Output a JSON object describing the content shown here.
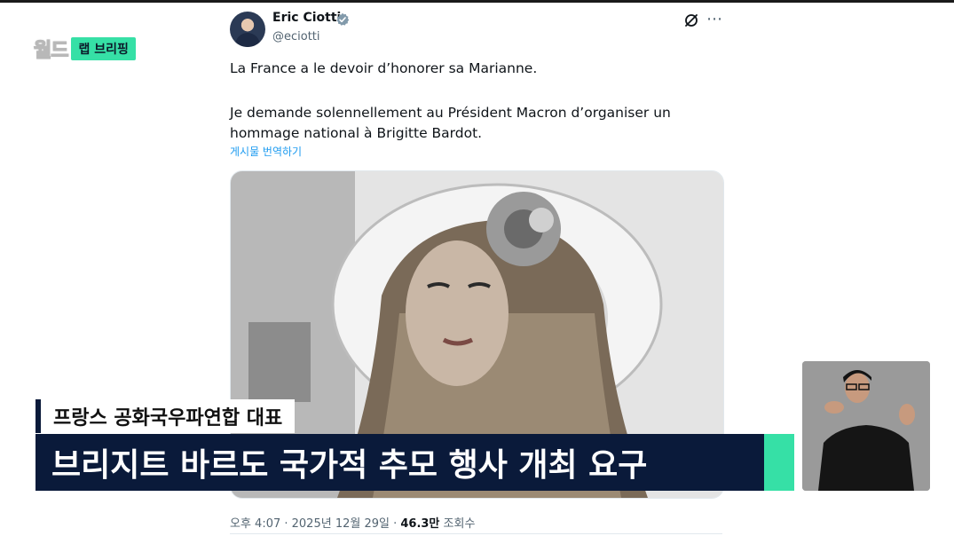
{
  "broadcast": {
    "logo_badge": "랩 브리핑"
  },
  "tweet": {
    "author_name": "Eric Ciotti",
    "author_handle": "@eciotti",
    "text_line1": "La France a le devoir d’honorer sa Marianne.",
    "text_line2": "Je demande solennellement au Président Macron d’organiser un",
    "text_line3": "hommage national à Brigitte Bardot.",
    "translate_link": "게시물 번역하기",
    "timestamp": "오후 4:07 · 2025년 12월 29일 · ",
    "views_count": "46.3만",
    "views_label": " 조회수"
  },
  "captions": {
    "subtitle": "프랑스 공화국우파연합 대표",
    "headline": "브리지트 바르도 국가적 추모 행사 개최 요구"
  },
  "colors": {
    "accent_mint": "#36e0a6",
    "caption_navy": "#0a1a3a",
    "link_blue": "#1d9bf0"
  },
  "icons": [
    "verified-badge-icon",
    "grok-icon",
    "more-options-icon"
  ]
}
